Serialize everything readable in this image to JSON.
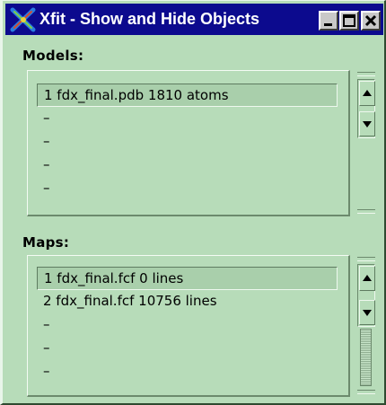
{
  "window": {
    "title": "Xfit - Show and Hide Objects",
    "icon": "xfit-app-icon",
    "controls": {
      "minimize": "minimize-icon",
      "maximize": "maximize-icon",
      "close": "close-icon"
    }
  },
  "models": {
    "heading": "Models:",
    "items": [
      {
        "label": "1 fdx_final.pdb 1810 atoms",
        "selected": true
      },
      {
        "label": "–"
      },
      {
        "label": "–"
      },
      {
        "label": "–"
      },
      {
        "label": "–"
      }
    ]
  },
  "maps": {
    "heading": "Maps:",
    "items": [
      {
        "label": "1 fdx_final.fcf 0 lines",
        "selected": true
      },
      {
        "label": "2 fdx_final.fcf 10756 lines"
      },
      {
        "label": "–"
      },
      {
        "label": "–"
      },
      {
        "label": "–"
      }
    ]
  },
  "colors": {
    "titlebar": "#0c0a8e",
    "window_bg": "#b7dcb9",
    "selection_bg": "#a9cfab"
  }
}
